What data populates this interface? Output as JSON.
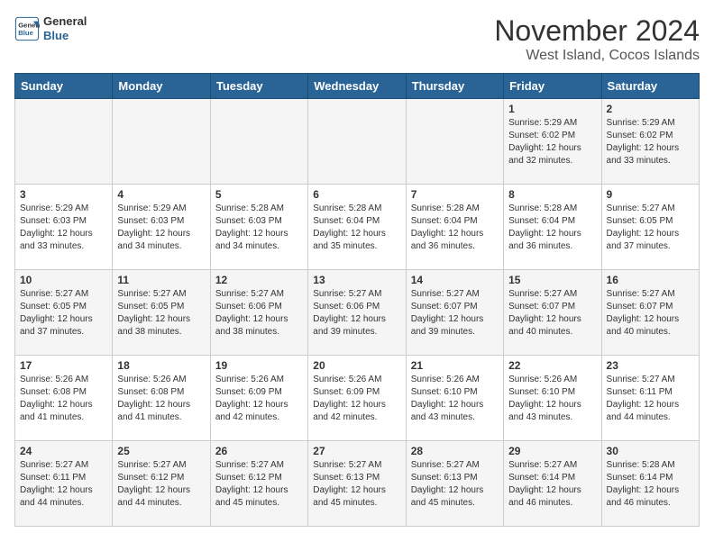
{
  "logo": {
    "line1": "General",
    "line2": "Blue"
  },
  "title": "November 2024",
  "location": "West Island, Cocos Islands",
  "weekdays": [
    "Sunday",
    "Monday",
    "Tuesday",
    "Wednesday",
    "Thursday",
    "Friday",
    "Saturday"
  ],
  "weeks": [
    [
      {
        "day": "",
        "info": ""
      },
      {
        "day": "",
        "info": ""
      },
      {
        "day": "",
        "info": ""
      },
      {
        "day": "",
        "info": ""
      },
      {
        "day": "",
        "info": ""
      },
      {
        "day": "1",
        "info": "Sunrise: 5:29 AM\nSunset: 6:02 PM\nDaylight: 12 hours\nand 32 minutes."
      },
      {
        "day": "2",
        "info": "Sunrise: 5:29 AM\nSunset: 6:02 PM\nDaylight: 12 hours\nand 33 minutes."
      }
    ],
    [
      {
        "day": "3",
        "info": "Sunrise: 5:29 AM\nSunset: 6:03 PM\nDaylight: 12 hours\nand 33 minutes."
      },
      {
        "day": "4",
        "info": "Sunrise: 5:29 AM\nSunset: 6:03 PM\nDaylight: 12 hours\nand 34 minutes."
      },
      {
        "day": "5",
        "info": "Sunrise: 5:28 AM\nSunset: 6:03 PM\nDaylight: 12 hours\nand 34 minutes."
      },
      {
        "day": "6",
        "info": "Sunrise: 5:28 AM\nSunset: 6:04 PM\nDaylight: 12 hours\nand 35 minutes."
      },
      {
        "day": "7",
        "info": "Sunrise: 5:28 AM\nSunset: 6:04 PM\nDaylight: 12 hours\nand 36 minutes."
      },
      {
        "day": "8",
        "info": "Sunrise: 5:28 AM\nSunset: 6:04 PM\nDaylight: 12 hours\nand 36 minutes."
      },
      {
        "day": "9",
        "info": "Sunrise: 5:27 AM\nSunset: 6:05 PM\nDaylight: 12 hours\nand 37 minutes."
      }
    ],
    [
      {
        "day": "10",
        "info": "Sunrise: 5:27 AM\nSunset: 6:05 PM\nDaylight: 12 hours\nand 37 minutes."
      },
      {
        "day": "11",
        "info": "Sunrise: 5:27 AM\nSunset: 6:05 PM\nDaylight: 12 hours\nand 38 minutes."
      },
      {
        "day": "12",
        "info": "Sunrise: 5:27 AM\nSunset: 6:06 PM\nDaylight: 12 hours\nand 38 minutes."
      },
      {
        "day": "13",
        "info": "Sunrise: 5:27 AM\nSunset: 6:06 PM\nDaylight: 12 hours\nand 39 minutes."
      },
      {
        "day": "14",
        "info": "Sunrise: 5:27 AM\nSunset: 6:07 PM\nDaylight: 12 hours\nand 39 minutes."
      },
      {
        "day": "15",
        "info": "Sunrise: 5:27 AM\nSunset: 6:07 PM\nDaylight: 12 hours\nand 40 minutes."
      },
      {
        "day": "16",
        "info": "Sunrise: 5:27 AM\nSunset: 6:07 PM\nDaylight: 12 hours\nand 40 minutes."
      }
    ],
    [
      {
        "day": "17",
        "info": "Sunrise: 5:26 AM\nSunset: 6:08 PM\nDaylight: 12 hours\nand 41 minutes."
      },
      {
        "day": "18",
        "info": "Sunrise: 5:26 AM\nSunset: 6:08 PM\nDaylight: 12 hours\nand 41 minutes."
      },
      {
        "day": "19",
        "info": "Sunrise: 5:26 AM\nSunset: 6:09 PM\nDaylight: 12 hours\nand 42 minutes."
      },
      {
        "day": "20",
        "info": "Sunrise: 5:26 AM\nSunset: 6:09 PM\nDaylight: 12 hours\nand 42 minutes."
      },
      {
        "day": "21",
        "info": "Sunrise: 5:26 AM\nSunset: 6:10 PM\nDaylight: 12 hours\nand 43 minutes."
      },
      {
        "day": "22",
        "info": "Sunrise: 5:26 AM\nSunset: 6:10 PM\nDaylight: 12 hours\nand 43 minutes."
      },
      {
        "day": "23",
        "info": "Sunrise: 5:27 AM\nSunset: 6:11 PM\nDaylight: 12 hours\nand 44 minutes."
      }
    ],
    [
      {
        "day": "24",
        "info": "Sunrise: 5:27 AM\nSunset: 6:11 PM\nDaylight: 12 hours\nand 44 minutes."
      },
      {
        "day": "25",
        "info": "Sunrise: 5:27 AM\nSunset: 6:12 PM\nDaylight: 12 hours\nand 44 minutes."
      },
      {
        "day": "26",
        "info": "Sunrise: 5:27 AM\nSunset: 6:12 PM\nDaylight: 12 hours\nand 45 minutes."
      },
      {
        "day": "27",
        "info": "Sunrise: 5:27 AM\nSunset: 6:13 PM\nDaylight: 12 hours\nand 45 minutes."
      },
      {
        "day": "28",
        "info": "Sunrise: 5:27 AM\nSunset: 6:13 PM\nDaylight: 12 hours\nand 45 minutes."
      },
      {
        "day": "29",
        "info": "Sunrise: 5:27 AM\nSunset: 6:14 PM\nDaylight: 12 hours\nand 46 minutes."
      },
      {
        "day": "30",
        "info": "Sunrise: 5:28 AM\nSunset: 6:14 PM\nDaylight: 12 hours\nand 46 minutes."
      }
    ]
  ]
}
